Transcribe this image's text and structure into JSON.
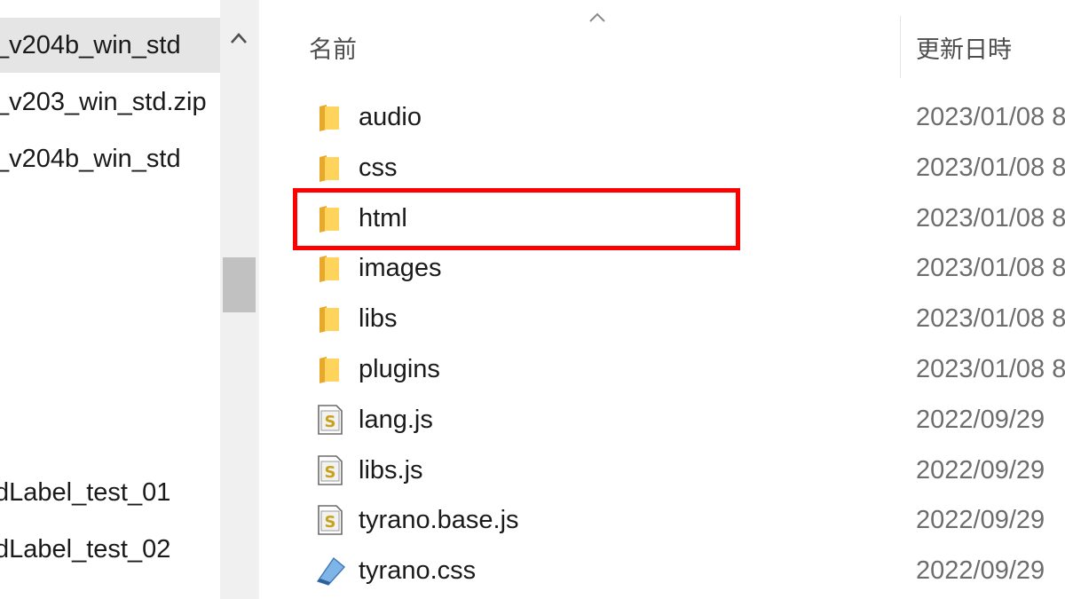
{
  "nav_pane": {
    "items": [
      {
        "label": "_v204b_win_std",
        "selected": true
      },
      {
        "label": "_v203_win_std.zip",
        "selected": false
      },
      {
        "label": "_v204b_win_std",
        "selected": false
      },
      {
        "label": "dLabel_test_01",
        "selected": false
      },
      {
        "label": "dLabel_test_02",
        "selected": false
      }
    ]
  },
  "columns": {
    "name": "名前",
    "date_modified": "更新日時"
  },
  "files": [
    {
      "name": "audio",
      "date": "2023/01/08 8",
      "icon": "folder-icon"
    },
    {
      "name": "css",
      "date": "2023/01/08 8",
      "icon": "folder-icon"
    },
    {
      "name": "html",
      "date": "2023/01/08 8",
      "icon": "folder-icon"
    },
    {
      "name": "images",
      "date": "2023/01/08 8",
      "icon": "folder-icon"
    },
    {
      "name": "libs",
      "date": "2023/01/08 8",
      "icon": "folder-icon"
    },
    {
      "name": "plugins",
      "date": "2023/01/08 8",
      "icon": "folder-icon"
    },
    {
      "name": "lang.js",
      "date": "2022/09/29",
      "icon": "js-file-icon"
    },
    {
      "name": "libs.js",
      "date": "2022/09/29",
      "icon": "js-file-icon"
    },
    {
      "name": "tyrano.base.js",
      "date": "2022/09/29",
      "icon": "js-file-icon"
    },
    {
      "name": "tyrano.css",
      "date": "2022/09/29",
      "icon": "css-file-icon"
    }
  ],
  "highlight": {
    "color": "#ff0000",
    "target": "html"
  },
  "colors": {
    "folder": "#f4c542",
    "selected_bg": "#e5e5e5",
    "scrollbar_track": "#f0f0f0",
    "scrollbar_thumb": "#c1c1c1"
  }
}
